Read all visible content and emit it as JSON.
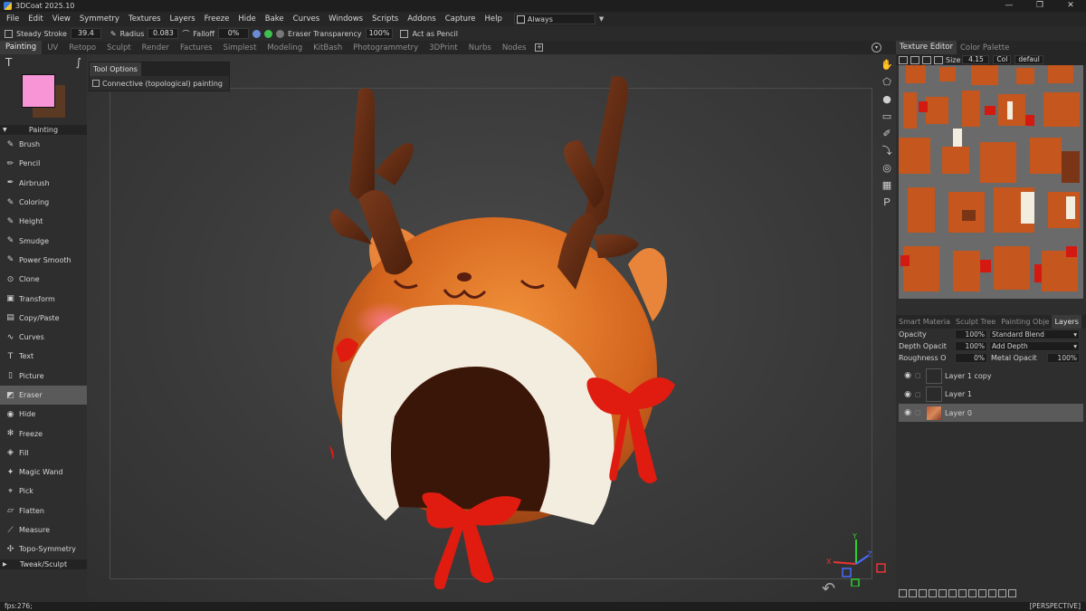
{
  "window": {
    "title": "3DCoat 2025.10",
    "controls": [
      "—",
      "❐",
      "✕"
    ]
  },
  "menu": [
    "File",
    "Edit",
    "View",
    "Symmetry",
    "Textures",
    "Layers",
    "Freeze",
    "Hide",
    "Bake",
    "Curves",
    "Windows",
    "Scripts",
    "Addons",
    "Capture",
    "Help"
  ],
  "menu_combo": {
    "label": "Always"
  },
  "toolbar": {
    "steady_stroke_label": "Steady  Stroke",
    "steady_stroke_value": "39.4",
    "radius_label": "Radius",
    "radius_value": "0.083",
    "falloff_label": "Falloff",
    "falloff_value": "0%",
    "eraser_transparency_label": "Eraser  Transparency",
    "eraser_transparency_value": "100%",
    "act_as_pencil_label": "Act  as  Pencil"
  },
  "room_tabs": [
    "Painting",
    "UV",
    "Retopo",
    "Sculpt",
    "Render",
    "Factures",
    "Simplest",
    "Modeling",
    "KitBash",
    "Photogrammetry",
    "3DPrint",
    "Nurbs",
    "Nodes"
  ],
  "room_active": "Painting",
  "left_panel": {
    "section_painting": "Painting",
    "section_tweak": "Tweak/Sculpt",
    "primary_color": "#f895d6",
    "secondary_color": "#5a3a22",
    "tools": [
      {
        "label": "Brush",
        "icon": "brush-icon",
        "glyph": "✎"
      },
      {
        "label": "Pencil",
        "icon": "pencil-icon",
        "glyph": "✏"
      },
      {
        "label": "Airbrush",
        "icon": "airbrush-icon",
        "glyph": "✒"
      },
      {
        "label": "Coloring",
        "icon": "coloring-icon",
        "glyph": "✎"
      },
      {
        "label": "Height",
        "icon": "height-icon",
        "glyph": "✎"
      },
      {
        "label": "Smudge",
        "icon": "smudge-icon",
        "glyph": "✎"
      },
      {
        "label": "Power  Smooth",
        "icon": "power-smooth-icon",
        "glyph": "✎"
      },
      {
        "label": "Clone",
        "icon": "clone-icon",
        "glyph": "⊙"
      },
      {
        "label": "Transform",
        "icon": "transform-icon",
        "glyph": "▣"
      },
      {
        "label": "Copy/Paste",
        "icon": "copy-paste-icon",
        "glyph": "▤"
      },
      {
        "label": "Curves",
        "icon": "curves-icon",
        "glyph": "∿"
      },
      {
        "label": "Text",
        "icon": "text-icon",
        "glyph": "T"
      },
      {
        "label": "Picture",
        "icon": "picture-icon",
        "glyph": "▯"
      },
      {
        "label": "Eraser",
        "icon": "eraser-icon",
        "glyph": "◩"
      },
      {
        "label": "Hide",
        "icon": "eye-icon",
        "glyph": "◉"
      },
      {
        "label": "Freeze",
        "icon": "snowflake-icon",
        "glyph": "✻"
      },
      {
        "label": "Fill",
        "icon": "fill-icon",
        "glyph": "◈"
      },
      {
        "label": "Magic  Wand",
        "icon": "magic-wand-icon",
        "glyph": "✦"
      },
      {
        "label": "Pick",
        "icon": "pick-icon",
        "glyph": "⌖"
      },
      {
        "label": "Flatten",
        "icon": "flatten-icon",
        "glyph": "▱"
      },
      {
        "label": "Measure",
        "icon": "measure-icon",
        "glyph": "⟋"
      },
      {
        "label": "Topo-Symmetry",
        "icon": "butterfly-icon",
        "glyph": "✣"
      }
    ],
    "active_tool": "Eraser"
  },
  "tool_options": {
    "title": "Tool  Options",
    "connective_label": "Connective  (topological)  painting"
  },
  "right_panel": {
    "tabs": [
      "Texture  Editor",
      "Color  Palette"
    ],
    "size_label": "Size",
    "size_value": "4.15",
    "combo1": "Col",
    "combo2": "defaul",
    "layer_tabs": [
      "Smart  Materia",
      "Sculpt  Tree",
      "Painting  Obje",
      "Layers"
    ],
    "opacity_label": "Opacity",
    "opacity_value": "100%",
    "blend_value": "Standard  Blend",
    "depth_label": "Depth  Opacit",
    "depth_value": "100%",
    "depth_mode": "Add  Depth",
    "roughness_label": "Roughness  O",
    "roughness_value": "0%",
    "metal_label": "Metal  Opacit",
    "metal_value": "100%",
    "layers": [
      {
        "name": "Layer  1  copy",
        "active": false
      },
      {
        "name": "Layer  1",
        "active": false
      },
      {
        "name": "Layer  0",
        "active": true
      }
    ]
  },
  "status": {
    "fps": "fps:276;",
    "projection": "[PERSPECTIVE]"
  },
  "gizmo": {
    "x": "X",
    "y": "Y",
    "z": "Z"
  }
}
